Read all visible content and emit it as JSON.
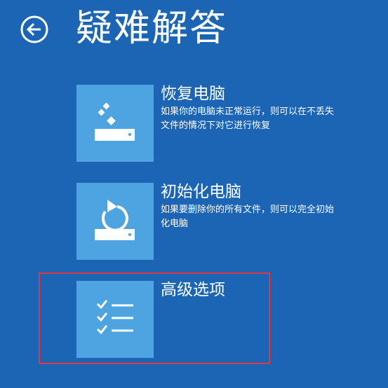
{
  "header": {
    "back_icon": "back-arrow-icon",
    "title": "疑难解答"
  },
  "options": [
    {
      "icon": "reset-drive-sparkle-icon",
      "title": "恢复电脑",
      "description": "如果你的电脑未正常运行，则可以在不丢失文件的情况下对它进行恢复"
    },
    {
      "icon": "refresh-drive-icon",
      "title": "初始化电脑",
      "description": "如果要删除你的所有文件，则可以完全初始化电脑"
    },
    {
      "icon": "checklist-icon",
      "title": "高级选项",
      "description": ""
    }
  ],
  "colors": {
    "background": "#1c65b5",
    "tile": "#4ea4e0",
    "highlight": "#e0363f"
  }
}
